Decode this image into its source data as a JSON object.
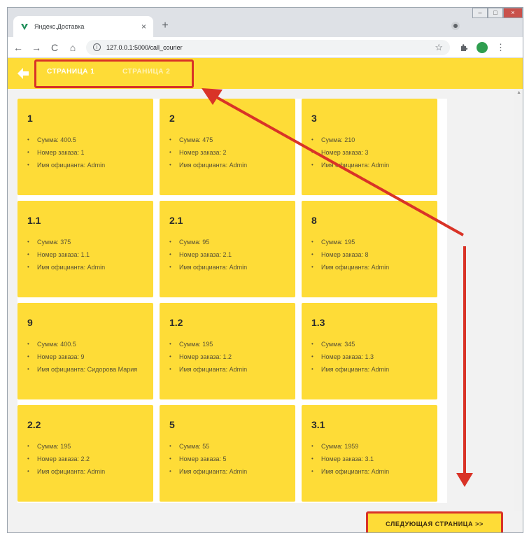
{
  "browser": {
    "tab_title": "Яндекс.Доставка",
    "tab_close": "×",
    "new_tab": "+",
    "url": "127.0.0.1:5000/call_courier",
    "nav": {
      "back": "←",
      "forward": "→",
      "reload": "C",
      "home": "⌂"
    },
    "star": "☆",
    "menu": "⋮",
    "icons": {
      "favicon": "yandex-delivery-icon",
      "extensions": "puzzle-icon",
      "profile": "avatar"
    }
  },
  "appbar": {
    "tabs": [
      {
        "label": "СТРАНИЦА 1",
        "active": true
      },
      {
        "label": "СТРАНИЦА 2",
        "active": false
      }
    ],
    "accent": "#fedc37"
  },
  "cards": [
    {
      "title": "1",
      "items": [
        "Сумма: 400.5",
        "Номер заказа: 1",
        "Имя официанта: Admin"
      ]
    },
    {
      "title": "2",
      "items": [
        "Сумма: 475",
        "Номер заказа: 2",
        "Имя официанта: Admin"
      ]
    },
    {
      "title": "3",
      "items": [
        "Сумма: 210",
        "Номер заказа: 3",
        "Имя официанта: Admin"
      ]
    },
    {
      "title": "1.1",
      "items": [
        "Сумма: 375",
        "Номер заказа: 1.1",
        "Имя официанта: Admin"
      ]
    },
    {
      "title": "2.1",
      "items": [
        "Сумма: 95",
        "Номер заказа: 2.1",
        "Имя официанта: Admin"
      ]
    },
    {
      "title": "8",
      "items": [
        "Сумма: 195",
        "Номер заказа: 8",
        "Имя официанта: Admin"
      ]
    },
    {
      "title": "9",
      "items": [
        "Сумма: 400.5",
        "Номер заказа: 9",
        "Имя официанта: Сидорова Мария"
      ]
    },
    {
      "title": "1.2",
      "items": [
        "Сумма: 195",
        "Номер заказа: 1.2",
        "Имя официанта: Admin"
      ]
    },
    {
      "title": "1.3",
      "items": [
        "Сумма: 345",
        "Номер заказа: 1.3",
        "Имя официанта: Admin"
      ]
    },
    {
      "title": "2.2",
      "items": [
        "Сумма: 195",
        "Номер заказа: 2.2",
        "Имя официанта: Admin"
      ]
    },
    {
      "title": "5",
      "items": [
        "Сумма: 55",
        "Номер заказа: 5",
        "Имя официанта: Admin"
      ]
    },
    {
      "title": "3.1",
      "items": [
        "Сумма: 1959",
        "Номер заказа: 3.1",
        "Имя официанта: Admin"
      ]
    }
  ],
  "next_button": {
    "label": "СЛЕДУЮЩАЯ СТРАНИЦА >>"
  },
  "annotation_color": "#d93327"
}
